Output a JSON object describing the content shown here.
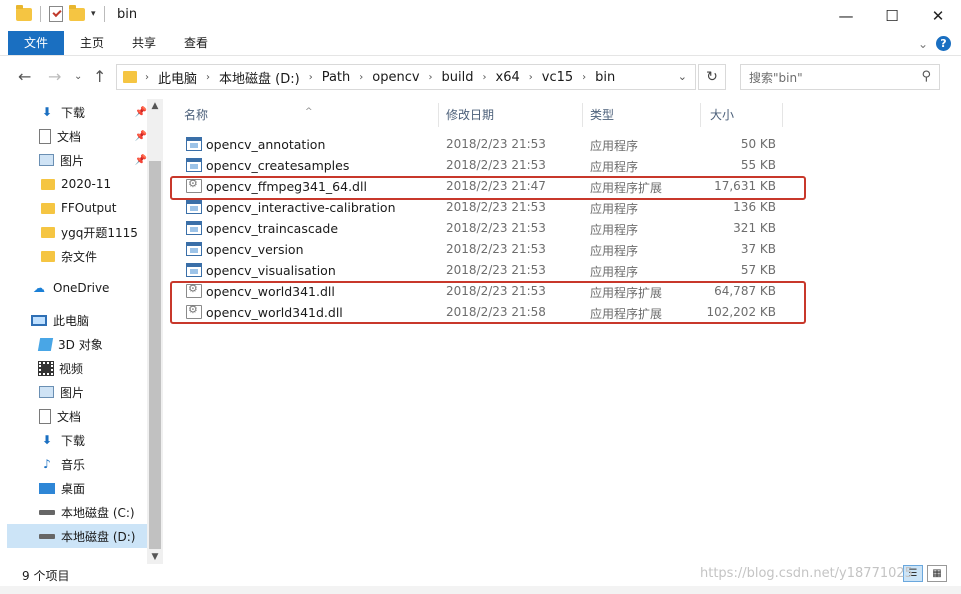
{
  "window": {
    "title": "bin",
    "minimize": "—",
    "maximize": "☐",
    "close": "✕"
  },
  "ribbon": {
    "tabs": [
      "文件",
      "主页",
      "共享",
      "查看"
    ],
    "help": "?"
  },
  "address": {
    "crumbs": [
      "此电脑",
      "本地磁盘 (D:)",
      "Path",
      "opencv",
      "build",
      "x64",
      "vc15",
      "bin"
    ],
    "search_placeholder": "搜索\"bin\""
  },
  "nav": {
    "quick_access": [
      {
        "label": "下载",
        "icon": "download-icon",
        "pinned": true
      },
      {
        "label": "文档",
        "icon": "document-icon",
        "pinned": true
      },
      {
        "label": "图片",
        "icon": "picture-icon",
        "pinned": true
      },
      {
        "label": "2020-11",
        "icon": "folder-icon",
        "pinned": false
      },
      {
        "label": "FFOutput",
        "icon": "folder-icon",
        "pinned": false
      },
      {
        "label": "ygq开题1115",
        "icon": "folder-icon",
        "pinned": false
      },
      {
        "label": "杂文件",
        "icon": "folder-icon",
        "pinned": false
      }
    ],
    "onedrive": "OneDrive",
    "this_pc": "此电脑",
    "pc_items": [
      {
        "label": "3D 对象",
        "icon": "3d-objects-icon"
      },
      {
        "label": "视频",
        "icon": "video-icon"
      },
      {
        "label": "图片",
        "icon": "picture-icon"
      },
      {
        "label": "文档",
        "icon": "document-icon"
      },
      {
        "label": "下载",
        "icon": "download-icon"
      },
      {
        "label": "音乐",
        "icon": "music-icon"
      },
      {
        "label": "桌面",
        "icon": "desktop-icon"
      },
      {
        "label": "本地磁盘 (C:)",
        "icon": "drive-icon"
      },
      {
        "label": "本地磁盘 (D:)",
        "icon": "drive-icon",
        "selected": true
      }
    ]
  },
  "columns": {
    "name": "名称",
    "date": "修改日期",
    "type": "类型",
    "size": "大小"
  },
  "files": [
    {
      "name": "opencv_annotation",
      "date": "2018/2/23 21:53",
      "type": "应用程序",
      "size": "50 KB",
      "kind": "exe"
    },
    {
      "name": "opencv_createsamples",
      "date": "2018/2/23 21:53",
      "type": "应用程序",
      "size": "55 KB",
      "kind": "exe"
    },
    {
      "name": "opencv_ffmpeg341_64.dll",
      "date": "2018/2/23 21:47",
      "type": "应用程序扩展",
      "size": "17,631 KB",
      "kind": "dll"
    },
    {
      "name": "opencv_interactive-calibration",
      "date": "2018/2/23 21:53",
      "type": "应用程序",
      "size": "136 KB",
      "kind": "exe"
    },
    {
      "name": "opencv_traincascade",
      "date": "2018/2/23 21:53",
      "type": "应用程序",
      "size": "321 KB",
      "kind": "exe"
    },
    {
      "name": "opencv_version",
      "date": "2018/2/23 21:53",
      "type": "应用程序",
      "size": "37 KB",
      "kind": "exe"
    },
    {
      "name": "opencv_visualisation",
      "date": "2018/2/23 21:53",
      "type": "应用程序",
      "size": "57 KB",
      "kind": "exe"
    },
    {
      "name": "opencv_world341.dll",
      "date": "2018/2/23 21:53",
      "type": "应用程序扩展",
      "size": "64,787 KB",
      "kind": "dll"
    },
    {
      "name": "opencv_world341d.dll",
      "date": "2018/2/23 21:58",
      "type": "应用程序扩展",
      "size": "102,202 KB",
      "kind": "dll"
    }
  ],
  "status": {
    "count": "9 个项目"
  },
  "watermark": "https://blog.csdn.net/y18771025",
  "highlight_color": "#c8382b",
  "accent_color": "#1a6fc1"
}
